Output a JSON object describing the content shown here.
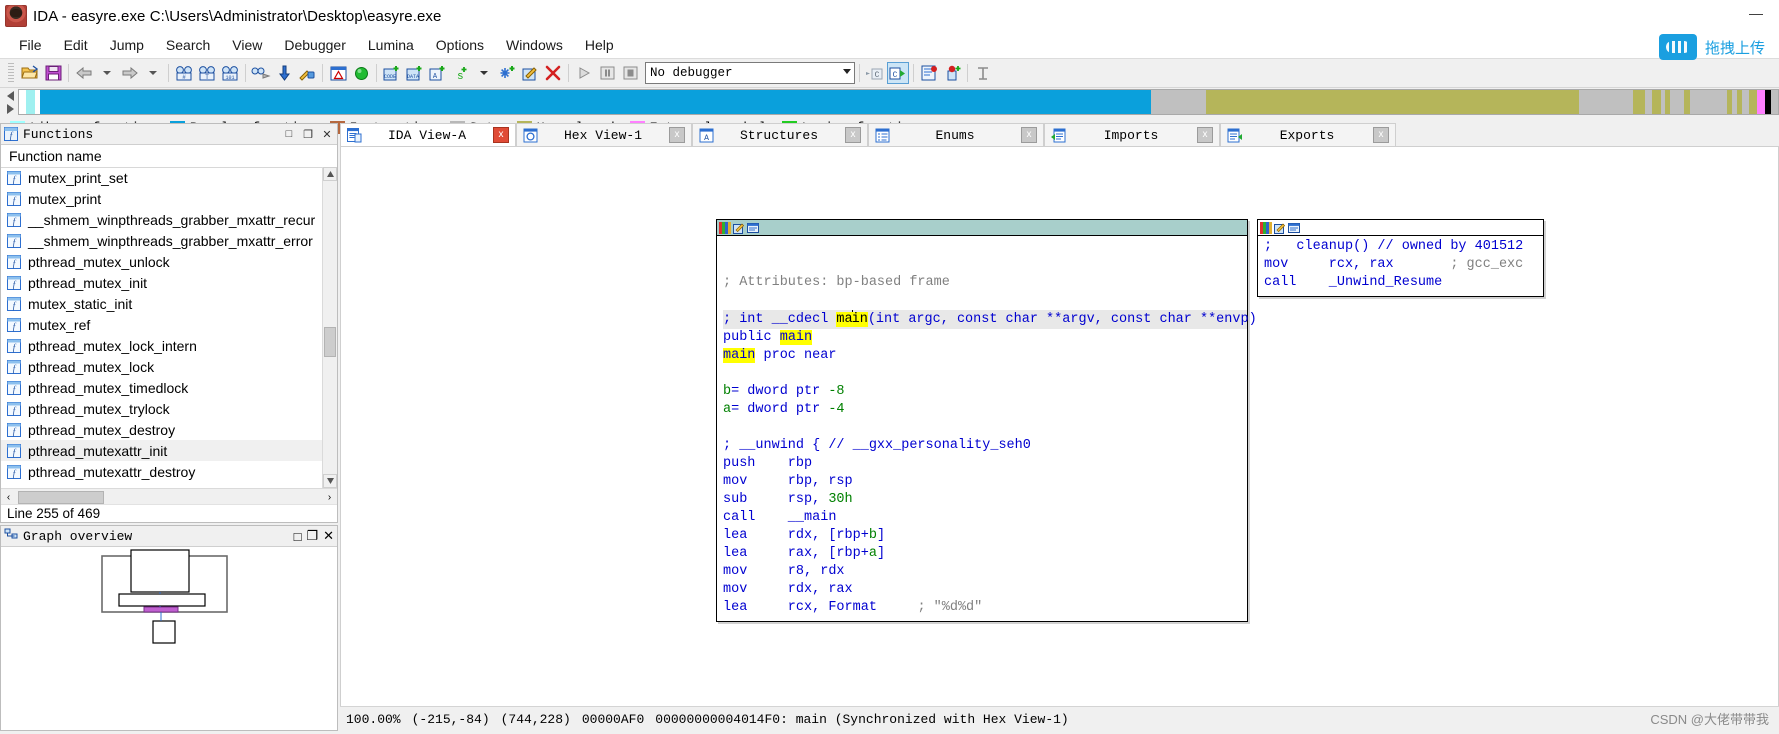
{
  "window": {
    "title": "IDA - easyre.exe C:\\Users\\Administrator\\Desktop\\easyre.exe",
    "app_icon": "ida-logo-icon",
    "minimize": "—",
    "maximize": "□",
    "close": "✕"
  },
  "menu": {
    "items": [
      "File",
      "Edit",
      "Jump",
      "Search",
      "View",
      "Debugger",
      "Lumina",
      "Options",
      "Windows",
      "Help"
    ]
  },
  "upload": {
    "label": "拖拽上传",
    "icon": "cloud-upload-icon",
    "color": "#1a9fe0"
  },
  "toolbar": {
    "debugger_select": "No debugger",
    "buttons": [
      {
        "name": "open-file-button",
        "icon": "folder-open-icon"
      },
      {
        "name": "save-file-button",
        "icon": "floppy-save-icon"
      },
      {
        "name": "navigate-back-button",
        "icon": "arrow-left-icon"
      },
      {
        "name": "navigate-back-dropdown",
        "icon": "chevron-down-icon"
      },
      {
        "name": "navigate-forward-button",
        "icon": "arrow-right-icon"
      },
      {
        "name": "navigate-forward-dropdown",
        "icon": "chevron-down-icon"
      },
      {
        "name": "search-number-button",
        "icon": "binoculars-hash-icon"
      },
      {
        "name": "search-text-button",
        "icon": "binoculars-text-icon"
      },
      {
        "name": "search-bytes-button",
        "icon": "binoculars-binary-icon"
      },
      {
        "name": "search-next-button",
        "icon": "binoculars-next-icon"
      },
      {
        "name": "jump-down-button",
        "icon": "blue-down-arrow-icon"
      },
      {
        "name": "decompile-button",
        "icon": "hammer-lock-icon"
      },
      {
        "name": "problems-button",
        "icon": "warning-window-icon"
      },
      {
        "name": "run-to-button",
        "icon": "green-circle-icon"
      },
      {
        "name": "make-code-button",
        "icon": "code-plus-icon"
      },
      {
        "name": "make-data-button",
        "icon": "data-plus-icon"
      },
      {
        "name": "make-array-button",
        "icon": "array-plus-icon"
      },
      {
        "name": "make-string-button",
        "icon": "string-plus-icon"
      },
      {
        "name": "make-string-dropdown",
        "icon": "chevron-down-icon"
      },
      {
        "name": "make-unexplored-button",
        "icon": "snowflake-plus-icon"
      },
      {
        "name": "rename-button",
        "icon": "pencil-edit-icon"
      },
      {
        "name": "undefine-button",
        "icon": "red-x-icon"
      },
      {
        "name": "start-process-button",
        "icon": "play-triangle-icon"
      },
      {
        "name": "pause-process-button",
        "icon": "pause-icon"
      },
      {
        "name": "stop-process-button",
        "icon": "stop-square-icon"
      },
      {
        "name": "step-into-button",
        "icon": "step-into-c-icon"
      },
      {
        "name": "step-over-button",
        "icon": "step-over-c-icon"
      },
      {
        "name": "breakpoint-list-button",
        "icon": "breakpoint-list-icon"
      },
      {
        "name": "add-breakpoint-button",
        "icon": "breakpoint-plus-icon"
      },
      {
        "name": "strings-window-button",
        "icon": "strings-icon"
      }
    ]
  },
  "navband": {
    "segments": [
      {
        "color": "#ffffff",
        "width": 0.4
      },
      {
        "color": "#9ff0f0",
        "width": 0.5
      },
      {
        "color": "#ffffff",
        "width": 0.3
      },
      {
        "color": "#0aa0dc",
        "width": 64.0
      },
      {
        "color": "#c0c0c0",
        "width": 3.2
      },
      {
        "color": "#b5b55a",
        "width": 21.5
      },
      {
        "color": "#c0c0c0",
        "width": 3.1
      },
      {
        "color": "#b5b55a",
        "width": 0.7
      },
      {
        "color": "#c0c0c0",
        "width": 0.4
      },
      {
        "color": "#b5b55a",
        "width": 0.5
      },
      {
        "color": "#c0c0c0",
        "width": 0.25
      },
      {
        "color": "#b5b55a",
        "width": 0.3
      },
      {
        "color": "#c0c0c0",
        "width": 0.8
      },
      {
        "color": "#b5b55a",
        "width": 0.35
      },
      {
        "color": "#c0c0c0",
        "width": 2.1
      },
      {
        "color": "#b5b55a",
        "width": 0.3
      },
      {
        "color": "#c0c0c0",
        "width": 0.3
      },
      {
        "color": "#b5b55a",
        "width": 0.3
      },
      {
        "color": "#c0c0c0",
        "width": 0.4
      },
      {
        "color": "#b5b55a",
        "width": 0.45
      },
      {
        "color": "#ff80ff",
        "width": 0.45
      },
      {
        "color": "#000000",
        "width": 0.35
      },
      {
        "color": "#c0c0c0",
        "width": 0.4
      }
    ],
    "left_arrow": "nav-left-arrow-icon",
    "right_arrow": "nav-right-arrow-icon"
  },
  "legend": {
    "entries": [
      {
        "label": "Library function",
        "color": "#a0ffff"
      },
      {
        "label": "Regular function",
        "color": "#0aa0dc"
      },
      {
        "label": "Instruction",
        "color": "#b5683f"
      },
      {
        "label": "Data",
        "color": "#b8b8b8"
      },
      {
        "label": "Unexplored",
        "color": "#b5b55a"
      },
      {
        "label": "External symbol",
        "color": "#ff80ff"
      },
      {
        "label": "Lumina function",
        "color": "#22cc22"
      }
    ]
  },
  "tabs": [
    {
      "label": "IDA View-A",
      "icon": "ida-view-icon",
      "active": true,
      "close": "x"
    },
    {
      "label": "Hex View-1",
      "icon": "hex-view-icon",
      "active": false,
      "close": "x"
    },
    {
      "label": "Structures",
      "icon": "structures-icon",
      "active": false,
      "close": "x"
    },
    {
      "label": "Enums",
      "icon": "enums-icon",
      "active": false,
      "close": "x"
    },
    {
      "label": "Imports",
      "icon": "imports-icon",
      "active": false,
      "close": "x"
    },
    {
      "label": "Exports",
      "icon": "exports-icon",
      "active": false,
      "close": "x"
    }
  ],
  "functions_panel": {
    "title": "Functions",
    "title_icon": "function-f-icon",
    "window_buttons": [
      "□",
      "❐",
      "✕"
    ],
    "column_header": "Function name",
    "items": [
      {
        "name": "mutex_print_set",
        "selected": false
      },
      {
        "name": "mutex_print",
        "selected": false
      },
      {
        "name": "__shmem_winpthreads_grabber_mxattr_recur",
        "selected": false
      },
      {
        "name": "__shmem_winpthreads_grabber_mxattr_error",
        "selected": false
      },
      {
        "name": "pthread_mutex_unlock",
        "selected": false
      },
      {
        "name": "pthread_mutex_init",
        "selected": false
      },
      {
        "name": "mutex_static_init",
        "selected": false
      },
      {
        "name": "mutex_ref",
        "selected": false
      },
      {
        "name": "pthread_mutex_lock_intern",
        "selected": false
      },
      {
        "name": "pthread_mutex_lock",
        "selected": false
      },
      {
        "name": "pthread_mutex_timedlock",
        "selected": false
      },
      {
        "name": "pthread_mutex_trylock",
        "selected": false
      },
      {
        "name": "pthread_mutex_destroy",
        "selected": false
      },
      {
        "name": "pthread_mutexattr_init",
        "selected": true
      },
      {
        "name": "pthread_mutexattr_destroy",
        "selected": false
      }
    ],
    "status": "Line 255 of 469",
    "scroll_left_arrow": "‹",
    "scroll_right_arrow": "›",
    "scroll_up_arrow": "▲",
    "scroll_down_arrow": "▼"
  },
  "graph_overview": {
    "title": "Graph overview",
    "title_icon": "graph-overview-icon",
    "window_buttons": [
      "□",
      "❐",
      "✕"
    ]
  },
  "graph": {
    "main_node": {
      "toolbar_icons": [
        "color-palette-icon",
        "edit-node-icon",
        "node-properties-icon"
      ],
      "lines": [
        {
          "text": "",
          "kind": "blank"
        },
        {
          "text": "",
          "kind": "blank"
        },
        {
          "text": "; Attributes: bp-based frame",
          "kind": "comment"
        },
        {
          "text": "",
          "kind": "blank"
        },
        {
          "text": "; int __cdecl main(int argc, const char **argv, const char **envp)",
          "kind": "proto"
        },
        {
          "text": "public main",
          "kind": "public"
        },
        {
          "text": "main proc near",
          "kind": "procnear"
        },
        {
          "text": "",
          "kind": "blank"
        },
        {
          "text": "b= dword ptr -8",
          "kind": "var"
        },
        {
          "text": "a= dword ptr -4",
          "kind": "var"
        },
        {
          "text": "",
          "kind": "blank"
        },
        {
          "text": "; __unwind { // __gxx_personality_seh0",
          "kind": "unwind"
        },
        {
          "text": "push    rbp",
          "kind": "insn"
        },
        {
          "text": "mov     rbp, rsp",
          "kind": "insn"
        },
        {
          "text": "sub     rsp, 30h",
          "kind": "insn_num"
        },
        {
          "text": "call    __main",
          "kind": "insn_call"
        },
        {
          "text": "lea     rdx, [rbp+b]",
          "kind": "insn_var_b"
        },
        {
          "text": "lea     rax, [rbp+a]",
          "kind": "insn_var_a"
        },
        {
          "text": "mov     r8, rdx",
          "kind": "insn"
        },
        {
          "text": "mov     rdx, rax",
          "kind": "insn"
        },
        {
          "text": "lea     rcx, Format     ; \"%d%d\"",
          "kind": "insn_fmt"
        }
      ]
    },
    "side_node": {
      "toolbar_icons": [
        "color-palette-icon",
        "edit-node-icon",
        "node-properties-icon"
      ],
      "lines": [
        {
          "text": ";   cleanup() // owned by 401512",
          "kind": "cleanup"
        },
        {
          "text": "mov     rcx, rax        ; gcc_exc",
          "kind": "insn_cmt"
        },
        {
          "text": "call    _Unwind_Resume",
          "kind": "insn_call"
        }
      ]
    }
  },
  "status_bar": {
    "zoom": "100.00%",
    "graph_coords": "(-215,-84)",
    "screen_coords": "(744,228)",
    "file_offset": "00000AF0",
    "address": "00000000004014F0: main (Synchronized with Hex View-1)"
  },
  "watermark": "CSDN @大佬带带我"
}
